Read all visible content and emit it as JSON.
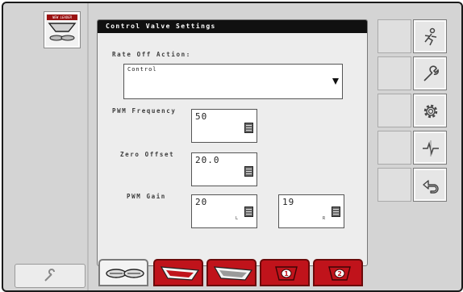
{
  "logo": {
    "text": "NEW LEADER"
  },
  "panel": {
    "title": "Control Valve Settings",
    "rate_off": {
      "label": "Rate Off Action:",
      "value": "Control"
    },
    "pwm_frequency": {
      "label": "PWM Frequency",
      "value": "50"
    },
    "zero_offset": {
      "label": "Zero Offset",
      "value": "20.0"
    },
    "pwm_gain": {
      "label": "PWM Gain",
      "left_value": "20",
      "left_sub": "L",
      "right_value": "19",
      "right_sub": "R"
    }
  },
  "tabs": [
    {
      "icon": "spinner-discs-icon",
      "active": true
    },
    {
      "icon": "bin-red-icon",
      "active": false
    },
    {
      "icon": "bin-gray-icon",
      "active": false
    },
    {
      "icon": "product-1-icon",
      "label": "1",
      "active": false
    },
    {
      "icon": "product-2-icon",
      "label": "2",
      "active": false
    }
  ],
  "right_buttons": [
    {
      "icon": "operator-icon"
    },
    {
      "icon": "wrench-icon"
    },
    {
      "icon": "gear-icon"
    },
    {
      "icon": "diagnostics-icon"
    },
    {
      "icon": "back-icon"
    }
  ],
  "colors": {
    "accent": "#c0131b",
    "title_bar": "#101010",
    "background": "#d4d4d4"
  }
}
